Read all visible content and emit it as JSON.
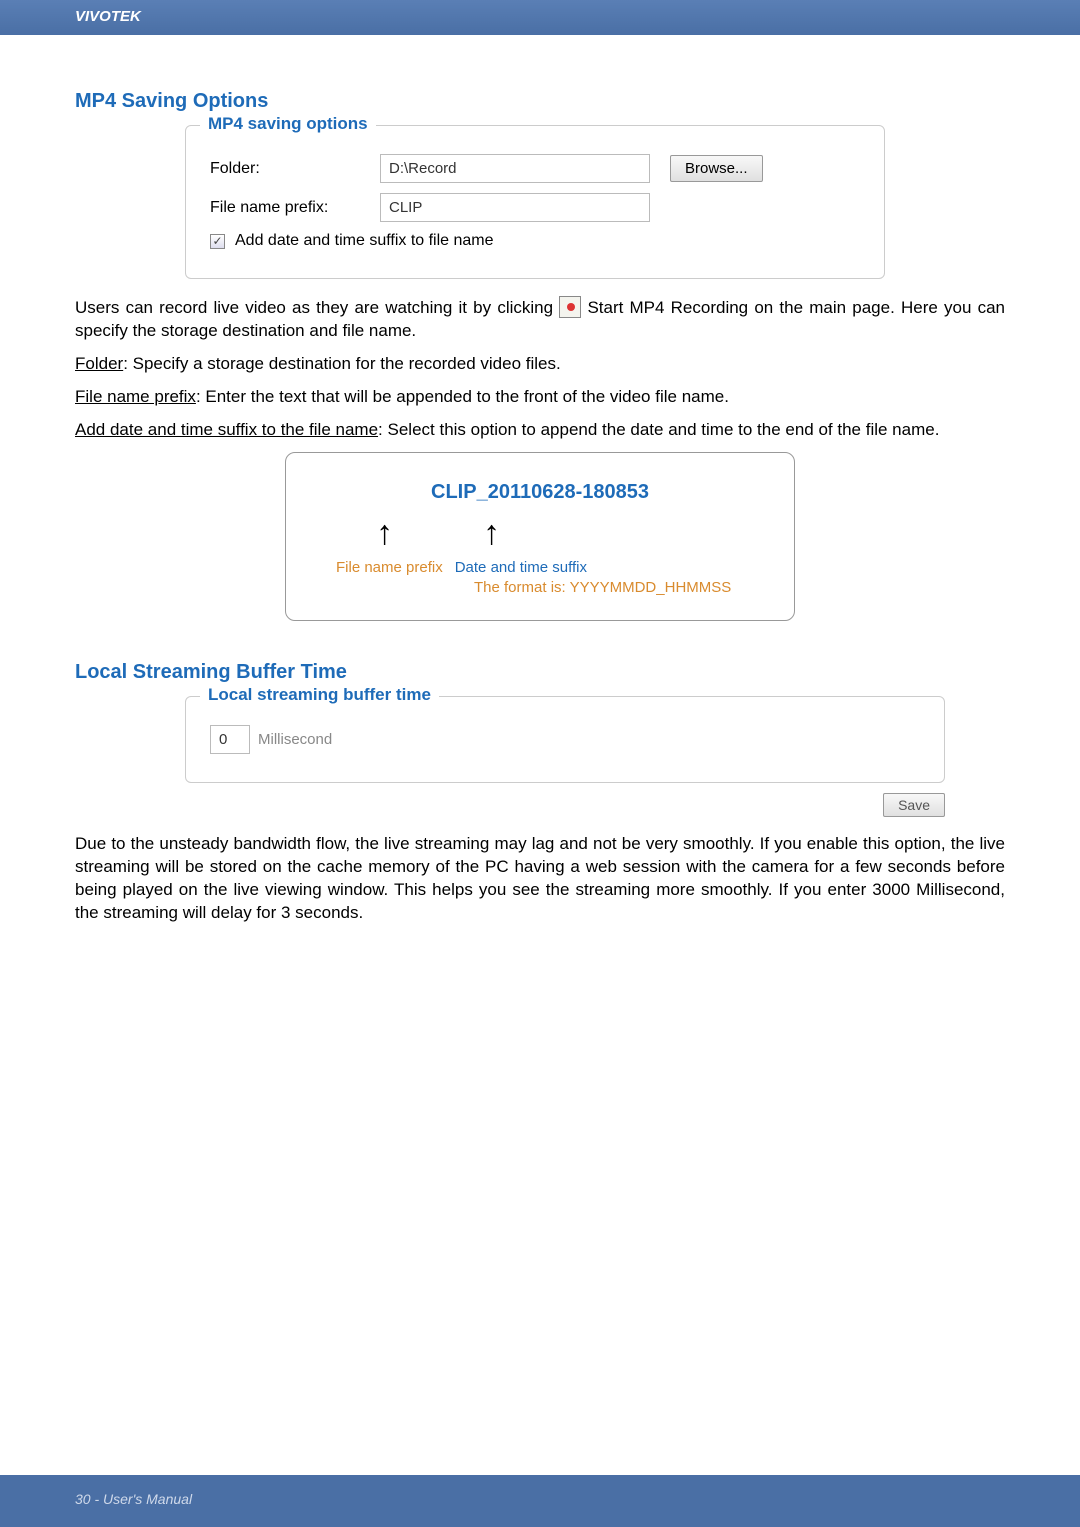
{
  "header": {
    "brand": "VIVOTEK"
  },
  "mp4": {
    "section_title": "MP4 Saving Options",
    "legend": "MP4 saving options",
    "folder_label": "Folder:",
    "folder_value": "D:\\Record",
    "browse_label": "Browse...",
    "prefix_label": "File name prefix:",
    "prefix_value": "CLIP",
    "suffix_checkbox_label": "Add date and time suffix to file name",
    "suffix_checked_glyph": "✓"
  },
  "body": {
    "para1a": "Users can record live video as they are watching it by clicking ",
    "para1b": " Start MP4 Recording on the main page. Here you can specify the storage destination and file name.",
    "folder_label": "Folder",
    "folder_desc": ": Specify a storage destination for the recorded video files.",
    "prefix_label": "File name prefix",
    "prefix_desc": ": Enter the text that will be appended to the front of the video file name.",
    "suffix_label": "Add date and time suffix to the file name",
    "suffix_desc": ": Select this option to append the date and time to the end of the file name."
  },
  "example": {
    "title": "CLIP_20110628-180853",
    "prefix_caption": "File name prefix",
    "suffix_caption": "Date and time suffix",
    "format_caption": "The format is: YYYYMMDD_HHMMSS"
  },
  "buffer": {
    "section_title": "Local Streaming Buffer Time",
    "legend": "Local streaming buffer time",
    "value": "0",
    "unit": "Millisecond",
    "save_label": "Save",
    "desc": "Due to the unsteady bandwidth flow, the live streaming may lag and not be very smoothly. If you enable this option, the live streaming will be stored on the cache memory of the PC having a web session with the camera for a few seconds before being played on the live viewing window. This helps you see the streaming more smoothly. If you enter 3000 Millisecond, the streaming will delay for 3 seconds."
  },
  "footer": {
    "text": "30 - User's Manual"
  }
}
